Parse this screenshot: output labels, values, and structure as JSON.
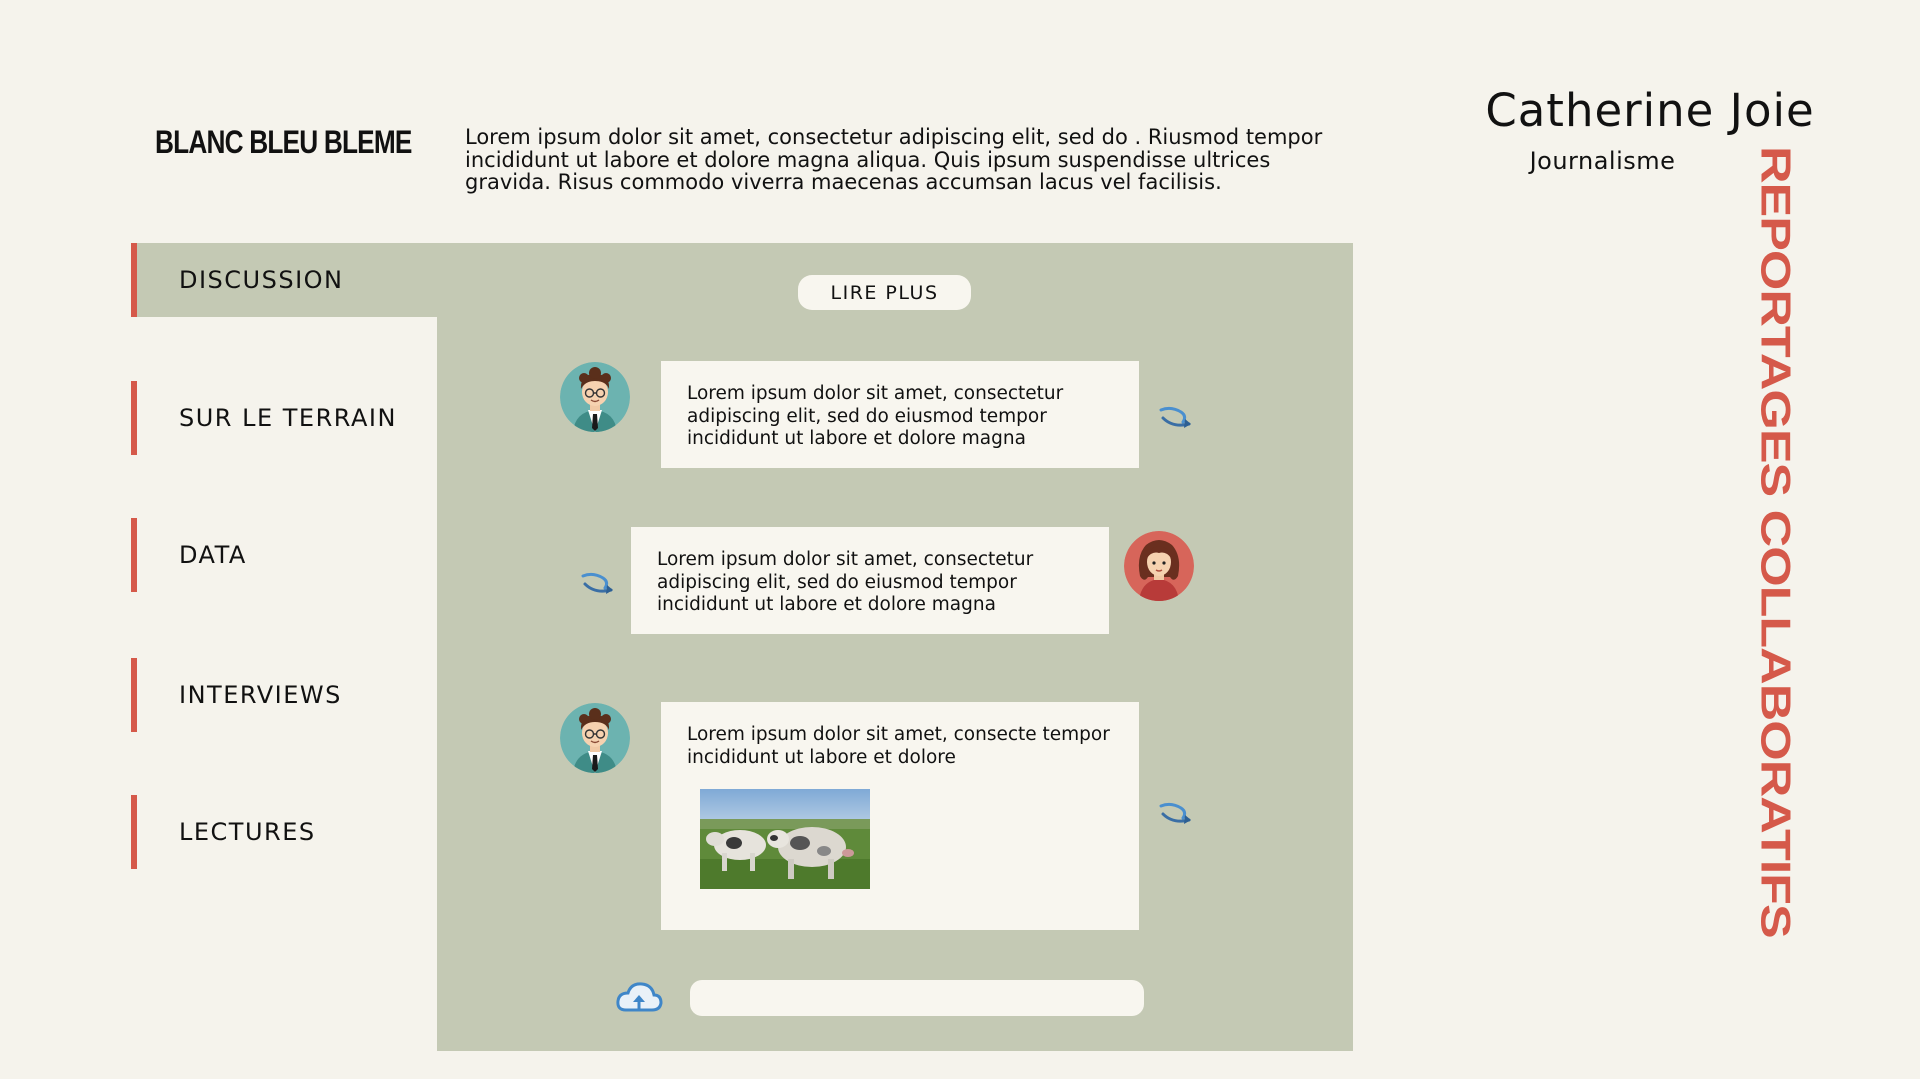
{
  "header": {
    "brand": "BLANC BLEU BLEME",
    "intro": "Lorem ipsum dolor sit amet, consectetur adipiscing elit, sed do . Riusmod tempor incididunt ut labore et dolore magna aliqua. Quis ipsum suspendisse ultrices gravida. Risus commodo viverra maecenas accumsan lacus vel facilisis."
  },
  "author": {
    "name": "Catherine Joie",
    "role": "Journalisme"
  },
  "vertical_title": "REPORTAGES COLLABORATIFS",
  "nav": {
    "items": [
      {
        "label": "DISCUSSION",
        "active": true
      },
      {
        "label": "SUR LE TERRAIN",
        "active": false
      },
      {
        "label": "DATA",
        "active": false
      },
      {
        "label": "INTERVIEWS",
        "active": false
      },
      {
        "label": "LECTURES",
        "active": false
      }
    ]
  },
  "chat": {
    "read_more": "LIRE PLUS",
    "messages": [
      {
        "sender": "male-avatar",
        "text": "Lorem ipsum dolor sit amet, consectetur adipiscing elit, sed do eiusmod tempor incididunt ut labore et dolore magna"
      },
      {
        "sender": "female-avatar",
        "text": "Lorem ipsum dolor sit amet, consectetur adipiscing elit, sed do eiusmod tempor incididunt ut labore et dolore magna"
      },
      {
        "sender": "male-avatar",
        "text": "Lorem ipsum dolor sit amet, consecte tempor incididunt ut labore et dolore",
        "attachment": "cow-photo"
      }
    ],
    "input_value": "",
    "upload_icon": "cloud-upload-icon"
  },
  "colors": {
    "accent": "#d5594a",
    "panel": "#c4c9b4",
    "background": "#f5f3ec",
    "bubble": "#f8f6ef"
  }
}
